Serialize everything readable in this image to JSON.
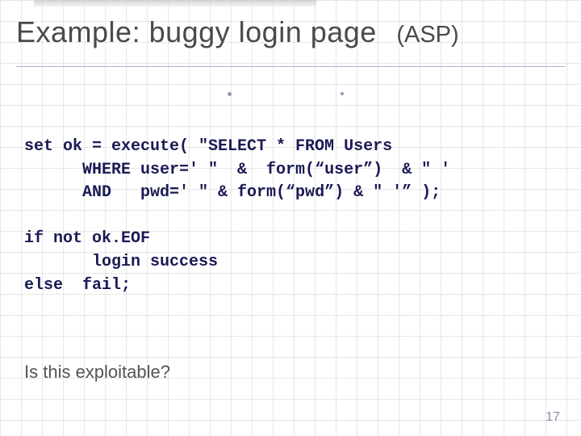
{
  "title": {
    "main": "Example:  buggy login page",
    "asp": "(ASP)"
  },
  "code": {
    "line1": "set ok = execute( \"SELECT * FROM Users",
    "line2": "      WHERE user=' \"  &  form(“user”)  & \" '",
    "line3": "      AND   pwd=' \" & form(“pwd”) & \" '” );",
    "blank1": "",
    "line4": "if not ok.EOF",
    "line5": "       login success",
    "line6": "else  fail;"
  },
  "question": "Is this exploitable?",
  "pagenum": "17"
}
